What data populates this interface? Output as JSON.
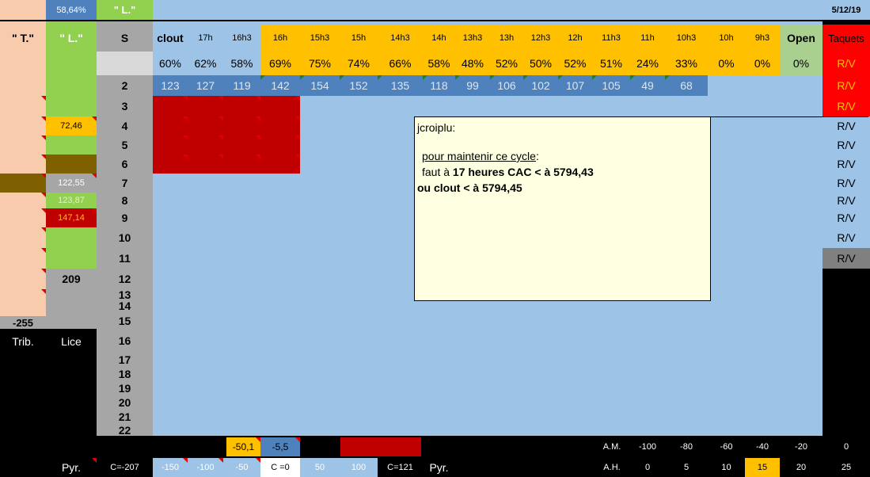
{
  "colors": {
    "salmon": "#f8cbad",
    "green": "#92d050",
    "gray": "#a6a6a6",
    "lightblue": "#9dc3e6",
    "blue": "#4f81bd",
    "orange": "#ffc000",
    "red": "#c00000",
    "brightred": "#ff0000",
    "brown": "#7f6000",
    "note": "#ffffe1"
  },
  "top": {
    "pct": "58,64%",
    "l_label": "\" L.\"",
    "date": "5/12/19"
  },
  "left": {
    "t_header": "\" T.\"",
    "l_header": "\" L.\"",
    "s_header": "S",
    "val_72": "72,46",
    "val_122": "122,55",
    "val_123": "123,87",
    "val_147": "147,14",
    "val_209": "209",
    "val_255": "-255",
    "trib": "Trib.",
    "lice": "Lice"
  },
  "s_numbers": [
    "2",
    "3",
    "4",
    "5",
    "6",
    "7",
    "8",
    "9",
    "10",
    "11",
    "12",
    "13",
    "14",
    "15",
    "16",
    "17",
    "18",
    "19",
    "20",
    "21",
    "22"
  ],
  "hours": [
    "clout",
    "17h",
    "16h3",
    "16h",
    "15h3",
    "15h",
    "14h3",
    "14h",
    "13h3",
    "13h",
    "12h3",
    "12h",
    "11h3",
    "11h",
    "10h3",
    "10h",
    "9h3",
    "Open"
  ],
  "percents": [
    "60%",
    "62%",
    "58%",
    "69%",
    "75%",
    "74%",
    "66%",
    "58%",
    "48%",
    "52%",
    "50%",
    "52%",
    "51%",
    "24%",
    "33%",
    "0%",
    "0%",
    "0%"
  ],
  "values": [
    "123",
    "127",
    "119",
    "142",
    "154",
    "152",
    "135",
    "118",
    "99",
    "106",
    "102",
    "107",
    "105",
    "49",
    "68"
  ],
  "taquets": {
    "header": "Taquets",
    "rv": "R/V"
  },
  "note": {
    "author": "jcroiplu:",
    "line1": "pour maintenir ce cycle",
    "line1_suffix": ":",
    "line2_prefix": "faut à ",
    "line2_bold": "17 heures CAC < à 5794,43",
    "line3": "ou clout < à 5794,45"
  },
  "bottom": {
    "row1": {
      "v1": "-50,1",
      "v2": "-5,5",
      "am": "A.M.",
      "am_vals": [
        "-100",
        "-80",
        "-60",
        "-40",
        "-20",
        "0"
      ]
    },
    "row2": {
      "pyr": "Pyr.",
      "c207": "C=-207",
      "scale": [
        "-150",
        "-100",
        "-50",
        "C =0",
        "50",
        "100"
      ],
      "c121": "C=121",
      "pyr2": "Pyr.",
      "ah": "A.H.",
      "ah_vals": [
        "0",
        "5",
        "10",
        "15",
        "20",
        "25"
      ]
    }
  }
}
